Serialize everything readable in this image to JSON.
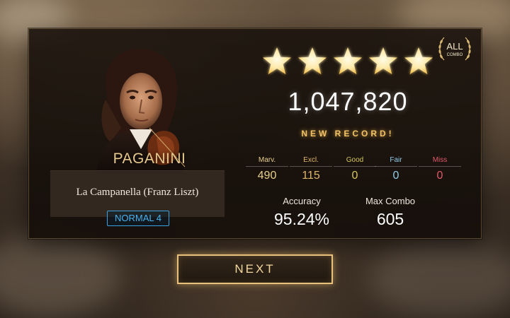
{
  "composer": {
    "name": "PAGANINI"
  },
  "song": {
    "title": "La Campanella (Franz Liszt)",
    "difficulty": "NORMAL 4"
  },
  "result": {
    "stars": 5,
    "score": "1,047,820",
    "new_record_text": "NEW RECORD!",
    "all_combo": {
      "top": "ALL",
      "bottom": "COMBO"
    }
  },
  "judgements": [
    {
      "label": "Marv.",
      "value": "490",
      "color": "#e9d08c"
    },
    {
      "label": "Excl.",
      "value": "115",
      "color": "#e0b66a"
    },
    {
      "label": "Good",
      "value": "0",
      "color": "#d7c65b"
    },
    {
      "label": "Fair",
      "value": "0",
      "color": "#8fcbe8"
    },
    {
      "label": "Miss",
      "value": "0",
      "color": "#e0596a"
    }
  ],
  "stats": {
    "accuracy_label": "Accuracy",
    "accuracy_value": "95.24%",
    "max_combo_label": "Max Combo",
    "max_combo_value": "605"
  },
  "next_button": {
    "label": "NEXT"
  }
}
